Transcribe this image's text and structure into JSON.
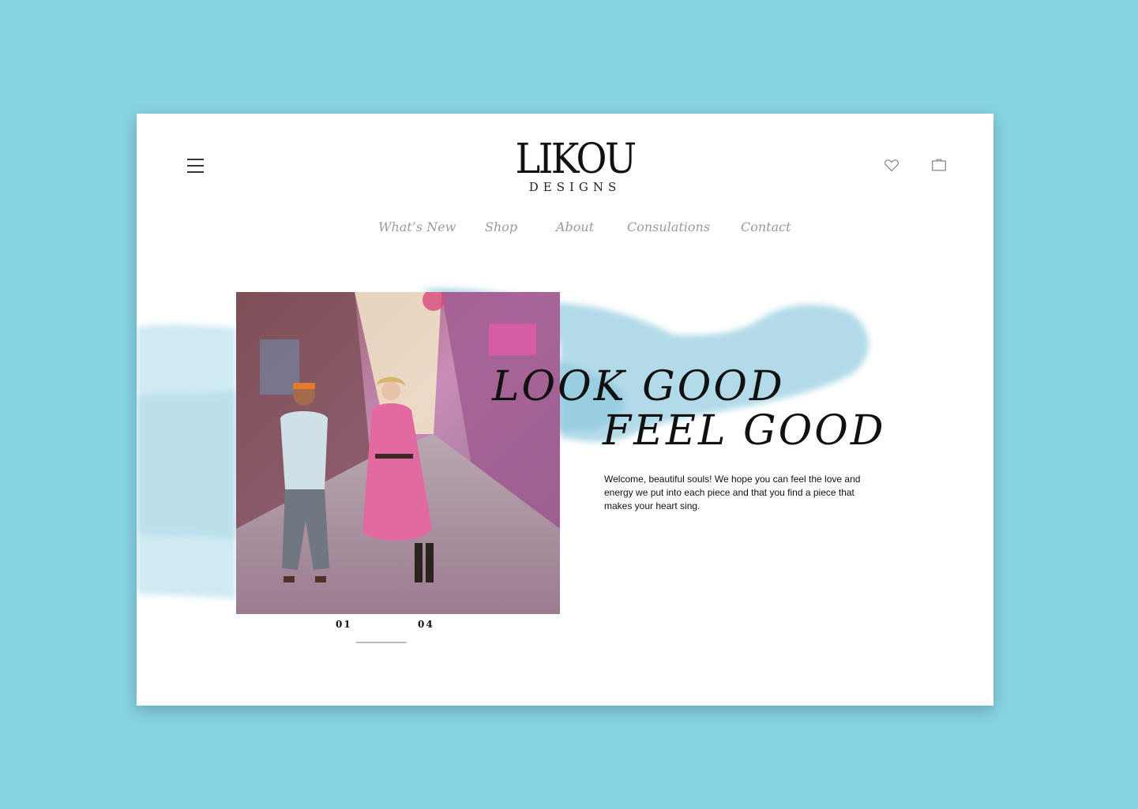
{
  "brand": {
    "name": "LIKOU",
    "tagline": "DESIGNS"
  },
  "nav": {
    "items": [
      {
        "label": "What’s New"
      },
      {
        "label": "Shop"
      },
      {
        "label": "About"
      },
      {
        "label": "Consulations"
      },
      {
        "label": "Contact"
      }
    ]
  },
  "icons": {
    "menu": "menu-icon",
    "favorites": "heart-icon",
    "cart": "bag-icon"
  },
  "hero": {
    "headline_line1": "LOOK GOOD",
    "headline_line2": "FEEL GOOD",
    "intro": "Welcome, beautiful souls! We hope you can feel the love and energy we put into each piece and that you find a piece that makes your heart sing."
  },
  "slider": {
    "current": "01",
    "total": "04",
    "progress": 0.25
  },
  "colors": {
    "background": "#86d3e4",
    "card": "#ffffff",
    "nav_text": "#9a9a9a",
    "wash": "#a9d8e6"
  }
}
